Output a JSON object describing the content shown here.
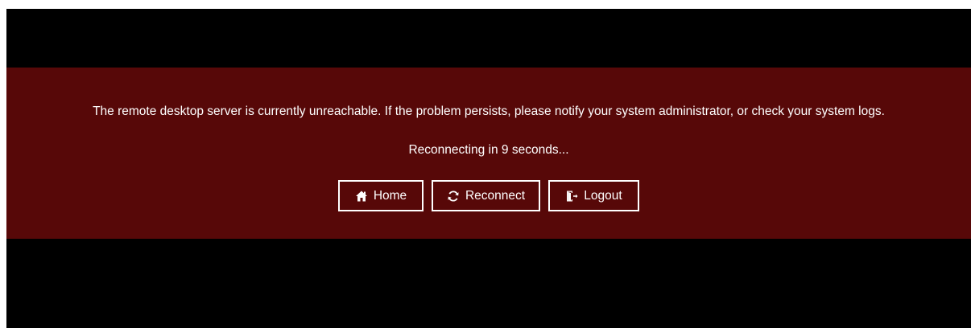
{
  "dialog": {
    "message": "The remote desktop server is currently unreachable. If the problem persists, please notify your system administrator, or check your system logs.",
    "status": "Reconnecting in 9 seconds..."
  },
  "actions": {
    "home_label": "Home",
    "reconnect_label": "Reconnect",
    "logout_label": "Logout"
  },
  "icons": {
    "home": "home-icon",
    "reconnect": "refresh-icon",
    "logout": "logout-icon"
  },
  "colors": {
    "background": "#000000",
    "banner": "#570808",
    "text": "#ffffff"
  }
}
